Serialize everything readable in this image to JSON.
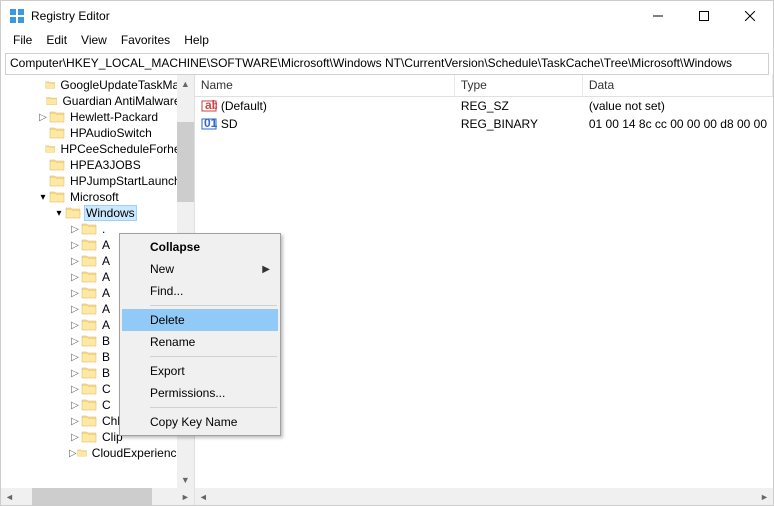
{
  "window": {
    "title": "Registry Editor"
  },
  "menu": {
    "file": "File",
    "edit": "Edit",
    "view": "View",
    "favorites": "Favorites",
    "help": "Help"
  },
  "addressbar": "Computer\\HKEY_LOCAL_MACHINE\\SOFTWARE\\Microsoft\\Windows NT\\CurrentVersion\\Schedule\\TaskCache\\Tree\\Microsoft\\Windows",
  "tree": {
    "items": [
      {
        "indent": 2,
        "expander": "",
        "label": "GoogleUpdateTaskMach"
      },
      {
        "indent": 2,
        "expander": "",
        "label": "Guardian AntiMalware S"
      },
      {
        "indent": 2,
        "expander": ">",
        "label": "Hewlett-Packard"
      },
      {
        "indent": 2,
        "expander": "",
        "label": "HPAudioSwitch"
      },
      {
        "indent": 2,
        "expander": "",
        "label": "HPCeeScheduleForhellc"
      },
      {
        "indent": 2,
        "expander": "",
        "label": "HPEA3JOBS"
      },
      {
        "indent": 2,
        "expander": "",
        "label": "HPJumpStartLaunch"
      },
      {
        "indent": 2,
        "expander": "v",
        "label": "Microsoft"
      },
      {
        "indent": 3,
        "expander": "v",
        "label": "Windows",
        "selected": true
      },
      {
        "indent": 4,
        "expander": ">",
        "label": "."
      },
      {
        "indent": 4,
        "expander": ">",
        "label": "A"
      },
      {
        "indent": 4,
        "expander": ">",
        "label": "A"
      },
      {
        "indent": 4,
        "expander": ">",
        "label": "A"
      },
      {
        "indent": 4,
        "expander": ">",
        "label": "A"
      },
      {
        "indent": 4,
        "expander": ">",
        "label": "A"
      },
      {
        "indent": 4,
        "expander": ">",
        "label": "A"
      },
      {
        "indent": 4,
        "expander": ">",
        "label": "B"
      },
      {
        "indent": 4,
        "expander": ">",
        "label": "B"
      },
      {
        "indent": 4,
        "expander": ">",
        "label": "B"
      },
      {
        "indent": 4,
        "expander": ">",
        "label": "C"
      },
      {
        "indent": 4,
        "expander": ">",
        "label": "C"
      },
      {
        "indent": 4,
        "expander": ">",
        "label": "Chkdsk"
      },
      {
        "indent": 4,
        "expander": ">",
        "label": "Clip"
      },
      {
        "indent": 4,
        "expander": ">",
        "label": "CloudExperienceH"
      }
    ]
  },
  "list": {
    "headers": {
      "name": "Name",
      "type": "Type",
      "data": "Data"
    },
    "rows": [
      {
        "icon": "string",
        "name": "(Default)",
        "type": "REG_SZ",
        "data": "(value not set)"
      },
      {
        "icon": "binary",
        "name": "SD",
        "type": "REG_BINARY",
        "data": "01 00 14 8c cc 00 00 00 d8 00 00"
      }
    ]
  },
  "context_menu": {
    "collapse": "Collapse",
    "new": "New",
    "find": "Find...",
    "delete": "Delete",
    "rename": "Rename",
    "export": "Export",
    "permissions": "Permissions...",
    "copy_key_name": "Copy Key Name"
  }
}
